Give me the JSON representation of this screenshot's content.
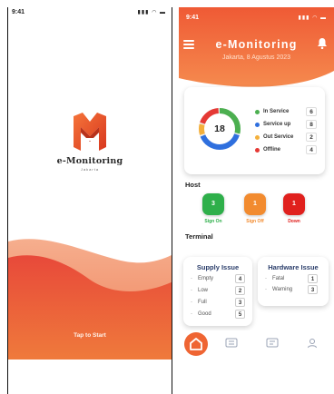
{
  "splash": {
    "status_time": "9:41",
    "logo_name": "e-Monitoring",
    "logo_sub": "Jakarta",
    "cta_label": "Tap to Start"
  },
  "dashboard": {
    "status_time": "9:41",
    "title": "e-Monitoring",
    "date": "Jakarta, 8 Agustus 2023",
    "summary": {
      "total": "18",
      "items": [
        {
          "label": "In Service",
          "count": "6",
          "color": "#4caf50"
        },
        {
          "label": "Service up",
          "count": "8",
          "color": "#2f6fde"
        },
        {
          "label": "Out Service",
          "count": "2",
          "color": "#f4b03c"
        },
        {
          "label": "Offline",
          "count": "4",
          "color": "#e53935"
        }
      ]
    },
    "host": {
      "title": "Host",
      "items": [
        {
          "label": "Sign On",
          "count": "3",
          "color": "#2eaf4a"
        },
        {
          "label": "Sign Off",
          "count": "1",
          "color": "#f28b2f"
        },
        {
          "label": "Down",
          "count": "1",
          "color": "#e0201d"
        }
      ]
    },
    "terminal": {
      "title": "Terminal",
      "supply": {
        "title": "Supply Issue",
        "rows": [
          {
            "label": "Empty",
            "count": "4"
          },
          {
            "label": "Low",
            "count": "2"
          },
          {
            "label": "Full",
            "count": "3"
          },
          {
            "label": "Good",
            "count": "5"
          }
        ]
      },
      "hardware": {
        "title": "Hardware Issue",
        "rows": [
          {
            "label": "Fatal",
            "count": "1"
          },
          {
            "label": "Warning",
            "count": "3"
          }
        ]
      }
    },
    "nav": [
      "home-icon",
      "ticket-icon",
      "ticket-alt-icon",
      "user-icon"
    ]
  },
  "colors": {
    "accent": "#ef6533",
    "accent_light": "#f79a62",
    "text_dark": "#222222"
  }
}
